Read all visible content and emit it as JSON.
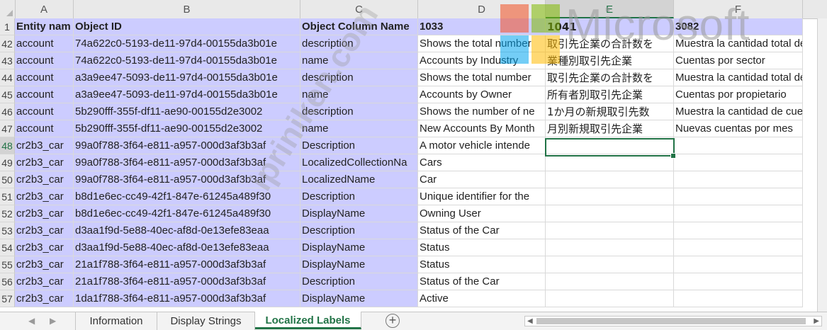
{
  "columns": [
    "A",
    "B",
    "C",
    "D",
    "E",
    "F"
  ],
  "header_row": {
    "num": "1",
    "cells": [
      "Entity nam",
      "Object ID",
      "Object Column Name",
      "1033",
      "1041",
      "3082"
    ]
  },
  "rows": [
    {
      "num": "42",
      "cells": [
        "account",
        "74a622c0-5193-de11-97d4-00155da3b01e",
        "description",
        "Shows the total number",
        "取引先企業の合計数を",
        "Muestra la cantidad total de"
      ]
    },
    {
      "num": "43",
      "cells": [
        "account",
        "74a622c0-5193-de11-97d4-00155da3b01e",
        "name",
        "Accounts by Industry",
        "業種別取引先企業",
        "Cuentas por sector"
      ]
    },
    {
      "num": "44",
      "cells": [
        "account",
        "a3a9ee47-5093-de11-97d4-00155da3b01e",
        "description",
        "Shows the total number",
        "取引先企業の合計数を",
        "Muestra la cantidad total de"
      ]
    },
    {
      "num": "45",
      "cells": [
        "account",
        "a3a9ee47-5093-de11-97d4-00155da3b01e",
        "name",
        "Accounts by Owner",
        "所有者別取引先企業",
        "Cuentas por propietario"
      ]
    },
    {
      "num": "46",
      "cells": [
        "account",
        "5b290fff-355f-df11-ae90-00155d2e3002",
        "description",
        "Shows the number of ne",
        "1か月の新規取引先数",
        "Muestra la cantidad de cue"
      ]
    },
    {
      "num": "47",
      "cells": [
        "account",
        "5b290fff-355f-df11-ae90-00155d2e3002",
        "name",
        "New Accounts By Month",
        "月別新規取引先企業",
        "Nuevas cuentas por mes"
      ]
    },
    {
      "num": "48",
      "cells": [
        "cr2b3_car",
        "99a0f788-3f64-e811-a957-000d3af3b3af",
        "Description",
        "A motor vehicle intende",
        "",
        ""
      ]
    },
    {
      "num": "49",
      "cells": [
        "cr2b3_car",
        "99a0f788-3f64-e811-a957-000d3af3b3af",
        "LocalizedCollectionNa",
        "Cars",
        "",
        ""
      ]
    },
    {
      "num": "50",
      "cells": [
        "cr2b3_car",
        "99a0f788-3f64-e811-a957-000d3af3b3af",
        "LocalizedName",
        "Car",
        "",
        ""
      ]
    },
    {
      "num": "51",
      "cells": [
        "cr2b3_car",
        "b8d1e6ec-cc49-42f1-847e-61245a489f30",
        "Description",
        "Unique identifier for the",
        "",
        ""
      ]
    },
    {
      "num": "52",
      "cells": [
        "cr2b3_car",
        "b8d1e6ec-cc49-42f1-847e-61245a489f30",
        "DisplayName",
        "Owning User",
        "",
        ""
      ]
    },
    {
      "num": "53",
      "cells": [
        "cr2b3_car",
        "d3aa1f9d-5e88-40ec-af8d-0e13efe83eaa",
        "Description",
        "Status of the Car",
        "",
        ""
      ]
    },
    {
      "num": "54",
      "cells": [
        "cr2b3_car",
        "d3aa1f9d-5e88-40ec-af8d-0e13efe83eaa",
        "DisplayName",
        "Status",
        "",
        ""
      ]
    },
    {
      "num": "55",
      "cells": [
        "cr2b3_car",
        "21a1f788-3f64-e811-a957-000d3af3b3af",
        "DisplayName",
        "Status",
        "",
        ""
      ]
    },
    {
      "num": "56",
      "cells": [
        "cr2b3_car",
        "21a1f788-3f64-e811-a957-000d3af3b3af",
        "Description",
        "Status of the Car",
        "",
        ""
      ]
    },
    {
      "num": "57",
      "cells": [
        "cr2b3_car",
        "1da1f788-3f64-e811-a957-000d3af3b3af",
        "DisplayName",
        "Active",
        "",
        ""
      ]
    }
  ],
  "sheet_tabs": [
    "Information",
    "Display Strings",
    "Localized Labels"
  ],
  "active_tab": "Localized Labels",
  "add_sheet_symbol": "+",
  "watermarks": {
    "brand": "Microsoft",
    "diagonal": "ipriniken.com"
  },
  "colors": {
    "lavender": "#ccccff",
    "excel_green": "#217346"
  },
  "icons": [
    "add-sheet-icon",
    "scroll-left-icon",
    "scroll-right-icon"
  ]
}
